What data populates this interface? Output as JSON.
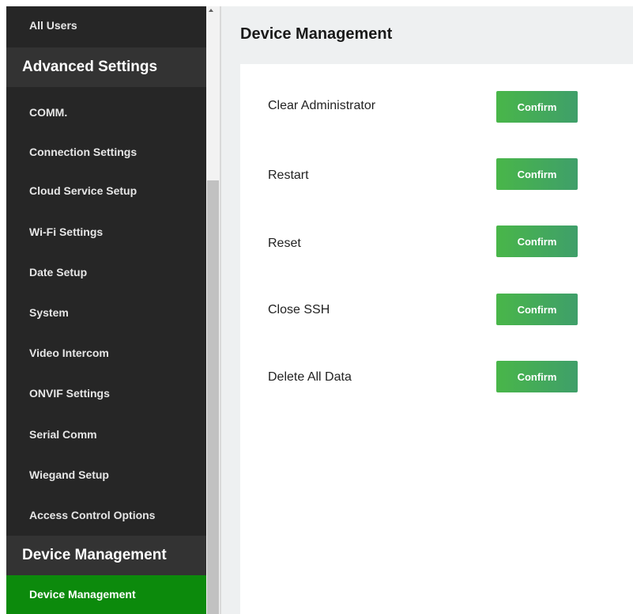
{
  "sidebar": {
    "items": [
      {
        "label": "All Users"
      },
      {
        "label": "Advanced Settings"
      },
      {
        "label": "COMM."
      },
      {
        "label": "Connection Settings"
      },
      {
        "label": "Cloud Service Setup"
      },
      {
        "label": "Wi-Fi Settings"
      },
      {
        "label": "Date Setup"
      },
      {
        "label": "System"
      },
      {
        "label": "Video Intercom"
      },
      {
        "label": "ONVIF Settings"
      },
      {
        "label": "Serial Comm"
      },
      {
        "label": "Wiegand Setup"
      },
      {
        "label": "Access Control Options"
      },
      {
        "label": "Device Management"
      },
      {
        "label": "Device Management"
      }
    ]
  },
  "main": {
    "title": "Device Management",
    "actions": [
      {
        "label": "Clear Administrator",
        "button": "Confirm"
      },
      {
        "label": "Restart",
        "button": "Confirm"
      },
      {
        "label": "Reset",
        "button": "Confirm"
      },
      {
        "label": "Close SSH",
        "button": "Confirm"
      },
      {
        "label": "Delete All Data",
        "button": "Confirm"
      }
    ]
  },
  "colors": {
    "sidebar_bg": "#262626",
    "section_bg": "#333333",
    "active_item": "#0c8a0c",
    "button_start": "#49b649",
    "button_end": "#3f9f6a"
  }
}
